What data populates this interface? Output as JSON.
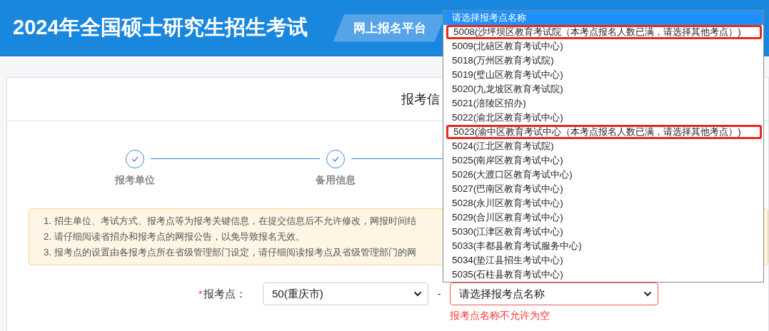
{
  "header": {
    "title": "2024年全国硕士研究生招生考试",
    "badge": "网上报名平台"
  },
  "card": {
    "title": "报考信",
    "steps": [
      {
        "label": "报考单位",
        "completed": true
      },
      {
        "label": "备用信息",
        "completed": true
      }
    ],
    "notice": [
      "1. 招生单位、考试方式、报考点等为报考关键信息，在提交信息后不允许修改，网报时间结",
      "2. 请仔细阅读省招办和报考点的网报公告，以免导致报名无效。",
      "3. 报考点的设置由各报考点所在省级管理部门设定，请仔细阅读报考点及省级管理部门的网"
    ],
    "form": {
      "label": "报考点：",
      "required_mark": "*",
      "province_select": {
        "value": "50(重庆市)"
      },
      "separator": "-",
      "site_select": {
        "value": "请选择报考点名称",
        "invalid": true
      },
      "error": "报考点名称不允许为空"
    }
  },
  "dropdown": {
    "options": [
      {
        "label": "请选择报考点名称",
        "selected": true,
        "marked": false
      },
      {
        "label": "5008(沙坪坝区教育考试院（本考点报名人数已满，请选择其他考点）)",
        "selected": false,
        "marked": true
      },
      {
        "label": "5009(北碚区教育考试中心)",
        "selected": false,
        "marked": false
      },
      {
        "label": "5018(万州区教育考试院)",
        "selected": false,
        "marked": false
      },
      {
        "label": "5019(璧山区教育考试中心)",
        "selected": false,
        "marked": false
      },
      {
        "label": "5020(九龙坡区教育考试院)",
        "selected": false,
        "marked": false
      },
      {
        "label": "5021(涪陵区招办)",
        "selected": false,
        "marked": false
      },
      {
        "label": "5022(渝北区教育考试中心)",
        "selected": false,
        "marked": false
      },
      {
        "label": "5023(渝中区教育考试中心（本考点报名人数已满，请选择其他考点）)",
        "selected": false,
        "marked": true
      },
      {
        "label": "5024(江北区教育考试院)",
        "selected": false,
        "marked": false
      },
      {
        "label": "5025(南岸区教育考试中心)",
        "selected": false,
        "marked": false
      },
      {
        "label": "5026(大渡口区教育考试中心)",
        "selected": false,
        "marked": false
      },
      {
        "label": "5027(巴南区教育考试中心)",
        "selected": false,
        "marked": false
      },
      {
        "label": "5028(永川区教育考试中心)",
        "selected": false,
        "marked": false
      },
      {
        "label": "5029(合川区教育考试中心)",
        "selected": false,
        "marked": false
      },
      {
        "label": "5030(江津区教育考试中心)",
        "selected": false,
        "marked": false
      },
      {
        "label": "5033(丰都县教育考试服务中心)",
        "selected": false,
        "marked": false
      },
      {
        "label": "5034(垫江县招生考试中心)",
        "selected": false,
        "marked": false
      },
      {
        "label": "5035(石柱县教育考试中心)",
        "selected": false,
        "marked": false
      }
    ]
  }
}
